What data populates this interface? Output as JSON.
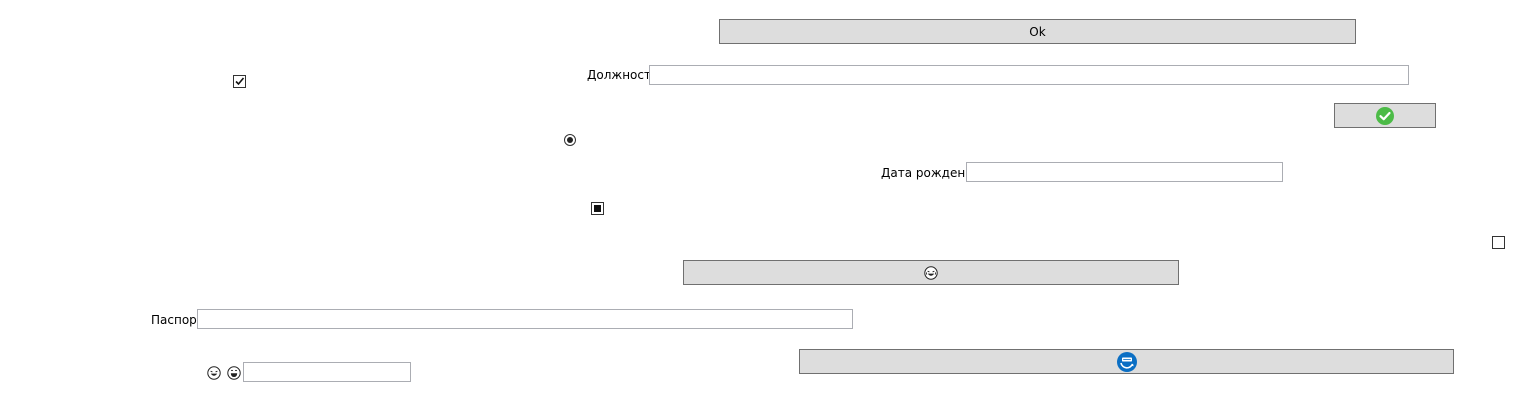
{
  "buttons": {
    "ok_label": "Ok",
    "check_icon": "check-circle-icon",
    "laughing_icon": "laughing-face-icon",
    "refresh_icon": "shield-refresh-icon"
  },
  "fields": {
    "position_label": "Должность",
    "position_value": "",
    "birthdate_label": "Дата рождения",
    "birthdate_value": "",
    "passport_label": "Паспорт",
    "passport_value": "",
    "emoji_field_value": ""
  },
  "controls": {
    "checkbox_checked": true,
    "radio_selected": true,
    "tristate_indeterminate": true,
    "checkbox_right_checked": false
  },
  "colors": {
    "button_bg": "#dddddd",
    "button_border": "#707070",
    "field_border": "#abadb3",
    "check_green": "#4cbb47",
    "refresh_blue": "#0b6fc4"
  }
}
